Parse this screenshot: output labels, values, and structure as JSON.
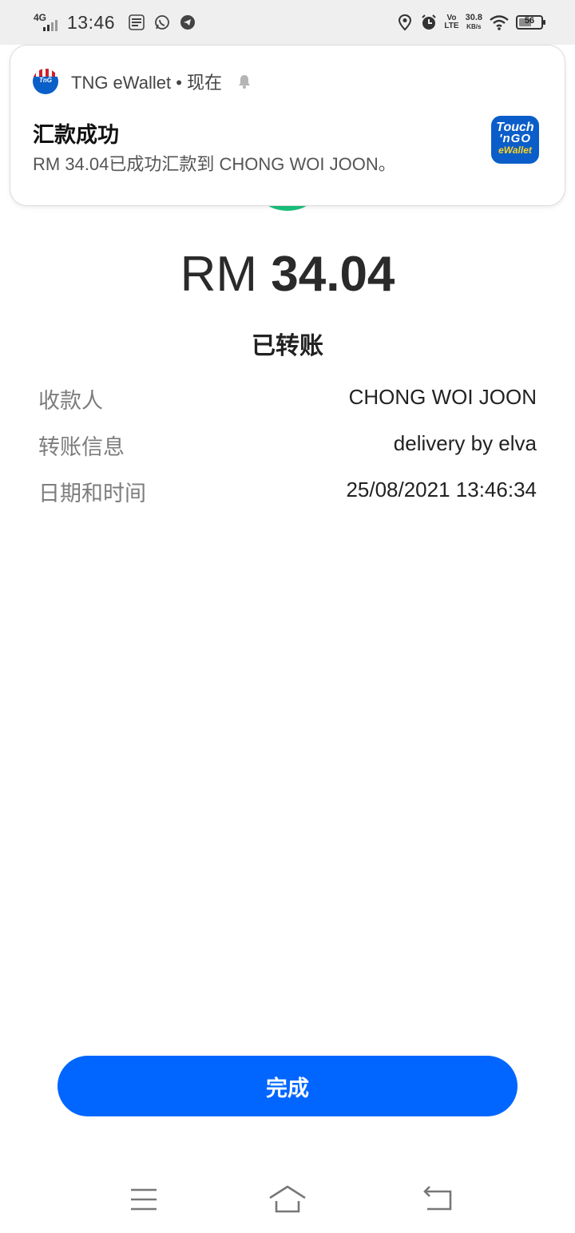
{
  "status_bar": {
    "network": "4G",
    "time": "13:46",
    "volte_line1": "Vo",
    "volte_line2": "LTE",
    "speed_value": "30.8",
    "speed_unit": "KB/s",
    "battery_percent": "56",
    "battery_level": 0.56
  },
  "notification": {
    "app_name": "TNG eWallet",
    "separator": " • ",
    "when": "现在",
    "title": "汇款成功",
    "body": "RM 34.04已成功汇款到 CHONG WOI JOON。",
    "logo_line1": "Touch",
    "logo_line2": "'nGO",
    "logo_line3": "eWallet"
  },
  "transfer": {
    "currency": "RM",
    "amount": "34.04",
    "status": "已转账"
  },
  "details": [
    {
      "label": "收款人",
      "value": "CHONG WOI JOON"
    },
    {
      "label": "转账信息",
      "value": "delivery by elva"
    },
    {
      "label": "日期和时间",
      "value": "25/08/2021 13:46:34"
    }
  ],
  "actions": {
    "done_label": "完成"
  },
  "colors": {
    "accent": "#0066ff",
    "success": "#19c37d",
    "brand": "#0b5ec9"
  }
}
